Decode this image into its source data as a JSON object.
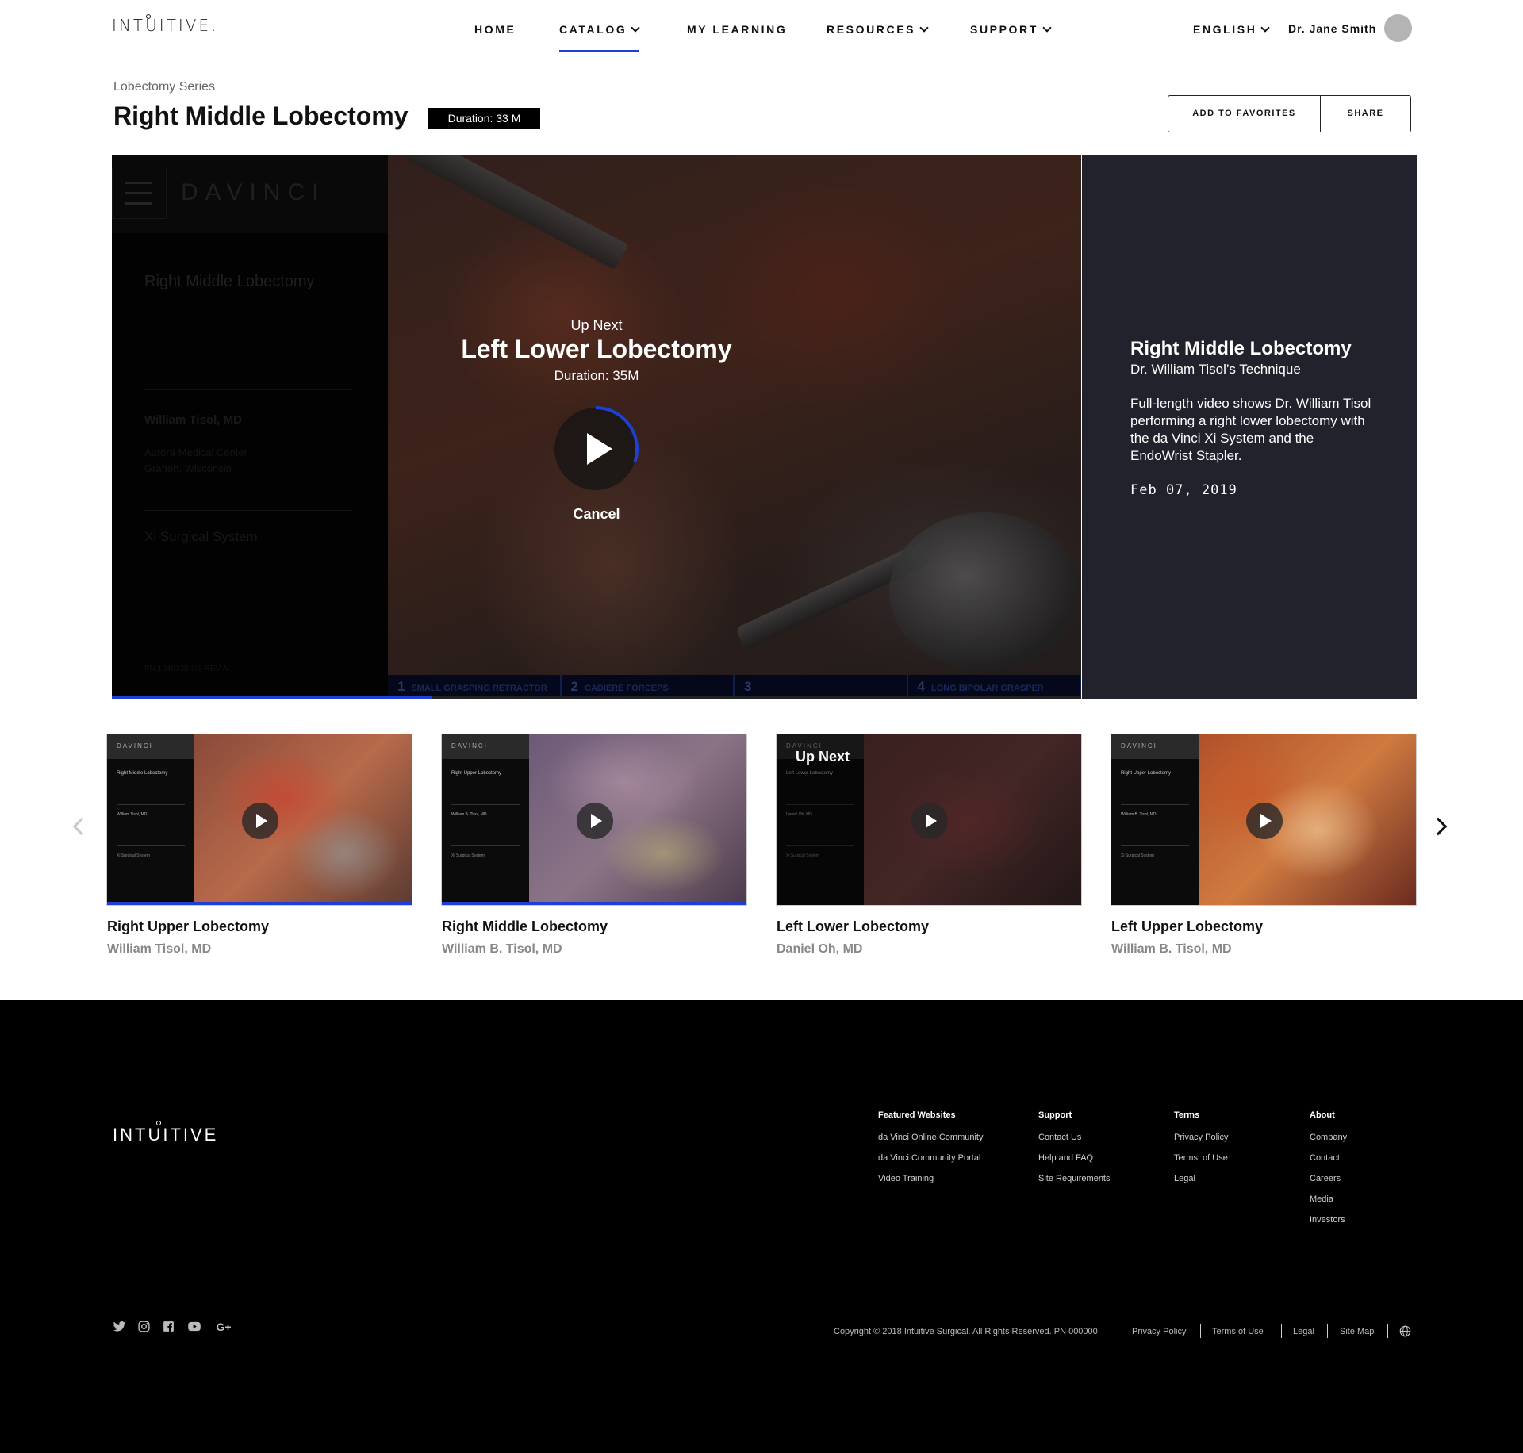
{
  "header": {
    "logo": "INTUITIVE.",
    "nav": [
      {
        "label": "HOME"
      },
      {
        "label": "CATALOG"
      },
      {
        "label": "MY LEARNING"
      },
      {
        "label": "RESOURCES"
      },
      {
        "label": "SUPPORT"
      }
    ],
    "language": "ENGLISH",
    "user_name": "Dr. Jane Smith",
    "active_nav": "CATALOG"
  },
  "page": {
    "series": "Lobectomy Series",
    "title": "Right Middle Lobectomy",
    "duration_badge": "Duration: 33 M",
    "add_favorites": "ADD TO FAVORITES",
    "share": "SHARE"
  },
  "player": {
    "sidebar": {
      "brand": "DAVINCI",
      "title": "Right Middle Lobectomy",
      "doctor": "William Tisol, MD",
      "hospital_line1": "Aurora Medical Center",
      "hospital_line2": "Grafton, Wisconsin",
      "system": "Xi Surgical System",
      "part_number": "PN 1046325-US REV A"
    },
    "toolbar": [
      {
        "num": "1",
        "label": "SMALL GRASPING RETRACTOR"
      },
      {
        "num": "2",
        "label": "CADIERE FORCEPS"
      },
      {
        "num": "3",
        "label": ""
      },
      {
        "num": "4",
        "label": "LONG BIPOLAR GRASPER"
      }
    ],
    "up_next_label": "Up Next",
    "up_next_title": "Left Lower Lobectomy",
    "up_next_duration": "Duration: 35M",
    "cancel": "Cancel",
    "progress_fraction": 0.33,
    "countdown_fraction": 0.3
  },
  "info": {
    "title": "Right Middle Lobectomy",
    "subtitle": "Dr. William Tisol’s Technique",
    "description": "Full-length video shows Dr. William Tisol performing a right lower lobectomy with the da Vinci Xi System and the EndoWrist Stapler.",
    "date": "Feb 07, 2019"
  },
  "carousel": {
    "cards": [
      {
        "title": "Right Upper Lobectomy",
        "author": "William Tisol, MD",
        "thumb_brand": "DAVINCI",
        "thumb_title": "Right Middle Lobectomy",
        "thumb_doctor": "William Tisol, MD",
        "thumb_system": "Xi Surgical System",
        "watched": 1.0,
        "up_next": false,
        "tone": "red"
      },
      {
        "title": "Right Middle Lobectomy",
        "author": "William B. Tisol, MD",
        "thumb_brand": "DAVINCI",
        "thumb_title": "Right Upper Lobectomy",
        "thumb_doctor": "William B. Tisol, MD",
        "thumb_system": "Xi Surgical System",
        "watched": 1.0,
        "up_next": false,
        "tone": "purple"
      },
      {
        "title": "Left Lower Lobectomy",
        "author": "Daniel Oh, MD",
        "thumb_brand": "DAVINCI",
        "thumb_title": "Left Lower Lobectomy",
        "thumb_doctor": "Daniel Oh, MD",
        "thumb_system": "Xi Surgical System",
        "watched": 0,
        "up_next": true,
        "up_next_label": "Up Next",
        "tone": "dark"
      },
      {
        "title": "Left Upper Lobectomy",
        "author": "William B. Tisol, MD",
        "thumb_brand": "DAVINCI",
        "thumb_title": "Right Upper Lobectomy",
        "thumb_doctor": "William B. Tisol, MD",
        "thumb_system": "Xi Surgical System",
        "watched": 0,
        "up_next": false,
        "tone": "orange"
      }
    ]
  },
  "footer": {
    "logo": "INTUITIVE",
    "columns": [
      {
        "heading": "Featured Websites",
        "links": [
          "da Vinci Online Community",
          "da Vinci Community Portal",
          "Video Training"
        ]
      },
      {
        "heading": "Support",
        "links": [
          "Contact Us",
          "Help and FAQ",
          "Site Requirements"
        ]
      },
      {
        "heading": "Terms",
        "links": [
          "Privacy Policy",
          "Terms  of Use",
          "Legal"
        ]
      },
      {
        "heading": "About",
        "links": [
          "Company",
          "Contact",
          "Careers",
          "Media",
          "Investors"
        ]
      }
    ],
    "copyright": "Copyright © 2018 Intuitive Surgical. All Rights Reserved. PN 000000",
    "legal_links": [
      "Privacy Policy",
      "Terms of Use",
      "Legal",
      "Site Map"
    ],
    "social_icons": [
      "twitter-icon",
      "instagram-icon",
      "facebook-icon",
      "youtube-icon",
      "google-plus-icon"
    ],
    "google_plus_label": "G+"
  },
  "colors": {
    "accent": "#1f3ed6",
    "info_panel": "#22222d",
    "footer_bg": "#000000"
  }
}
